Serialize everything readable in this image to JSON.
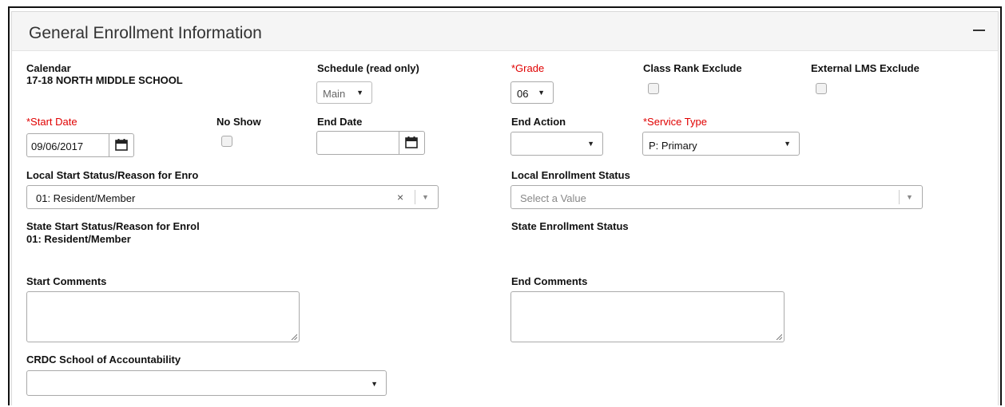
{
  "panel": {
    "title": "General Enrollment Information",
    "collapse_symbol": "−"
  },
  "calendar": {
    "label": "Calendar",
    "value": "17-18 NORTH MIDDLE SCHOOL"
  },
  "schedule": {
    "label": "Schedule (read only)",
    "value": "Main"
  },
  "grade": {
    "label": "*Grade",
    "value": "06"
  },
  "class_rank_exclude": {
    "label": "Class Rank Exclude",
    "checked": false
  },
  "external_lms_exclude": {
    "label": "External LMS Exclude",
    "checked": false
  },
  "start_date": {
    "label": "*Start Date",
    "value": "09/06/2017"
  },
  "no_show": {
    "label": "No Show",
    "checked": false
  },
  "end_date": {
    "label": "End Date",
    "value": ""
  },
  "end_action": {
    "label": "End Action",
    "value": ""
  },
  "service_type": {
    "label": "*Service Type",
    "value": "P: Primary"
  },
  "local_start_status": {
    "label": "Local Start Status/Reason for Enro",
    "value": "01: Resident/Member",
    "clear_symbol": "×"
  },
  "local_enrollment_status": {
    "label": "Local Enrollment Status",
    "placeholder": "Select a Value"
  },
  "state_start_status": {
    "label": "State Start Status/Reason for Enrol",
    "value": "01: Resident/Member"
  },
  "state_enrollment_status": {
    "label": "State Enrollment Status"
  },
  "start_comments": {
    "label": "Start Comments",
    "value": ""
  },
  "end_comments": {
    "label": "End Comments",
    "value": ""
  },
  "crdc_school": {
    "label": "CRDC School of Accountability",
    "value": ""
  },
  "icons": {
    "dropdown_arrow": "▼",
    "calendar": "calendar-icon"
  },
  "colors": {
    "required": "#e00000",
    "header_bg": "#f5f5f5"
  }
}
